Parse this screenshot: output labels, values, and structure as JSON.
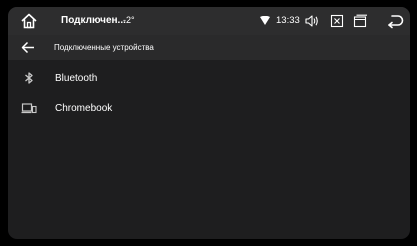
{
  "statusbar": {
    "app_title": "Подключен...",
    "temperature": "-2°",
    "time": "13:33",
    "icons": [
      "home-icon",
      "wifi-icon",
      "volume-icon",
      "close-box-icon",
      "window-icon",
      "back-arrow-icon"
    ]
  },
  "toolbar": {
    "back_icon": "arrow-left-icon",
    "title": "Подключенные устройства"
  },
  "devices": [
    {
      "label": "Bluetooth",
      "icon": "bluetooth-icon"
    },
    {
      "label": "Chromebook",
      "icon": "laptop-phone-icon"
    }
  ],
  "colors": {
    "background": "#1e1e1f",
    "statusbar": "#2d2d2e",
    "toolbar": "#2a2a2b",
    "text": "#ffffff",
    "icon": "#c8c8c8"
  }
}
